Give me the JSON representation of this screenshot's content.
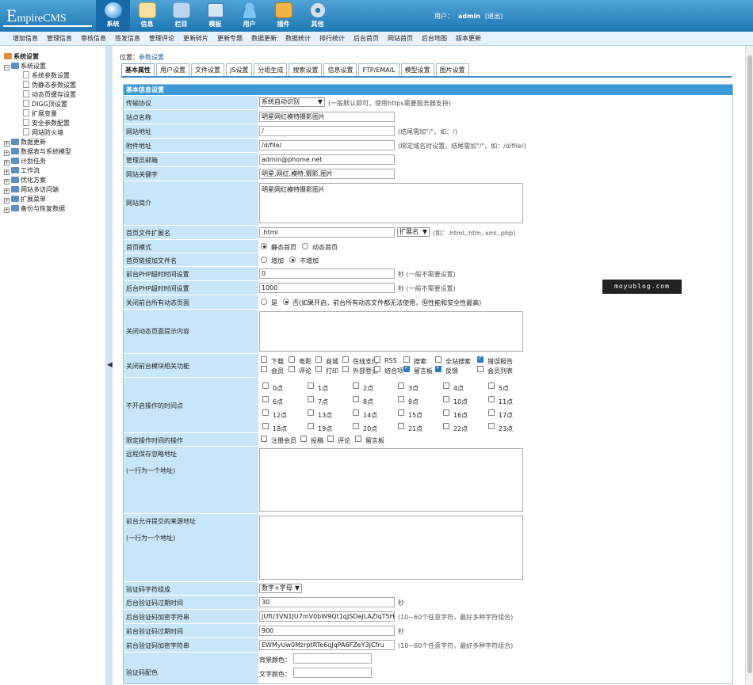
{
  "brand": {
    "logo_text": "EmpireCMS"
  },
  "nav": [
    {
      "label": "系统",
      "icon": "globe-icon",
      "active": true
    },
    {
      "label": "信息",
      "icon": "pencil-icon"
    },
    {
      "label": "栏目",
      "icon": "folder-icon"
    },
    {
      "label": "模板",
      "icon": "window-icon"
    },
    {
      "label": "用户",
      "icon": "user-icon"
    },
    {
      "label": "插件",
      "icon": "puzzle-icon"
    },
    {
      "label": "其他",
      "icon": "gear-icon"
    }
  ],
  "user": {
    "prefix": "用户：",
    "name": "admin",
    "logout": "[退出]"
  },
  "menu": [
    "增加信息",
    "管理信息",
    "审核信息",
    "签发信息",
    "管理评论",
    "更新碎片",
    "更新专题",
    "数据更新",
    "数据统计",
    "排行统计",
    "后台首页",
    "网站首页",
    "后台地图",
    "版本更新"
  ],
  "tree": {
    "root": "系统设置",
    "group": "系统设置",
    "pages": [
      "系统参数设置",
      "伪静态参数设置",
      "动态页缓存设置",
      "DIGG顶设置",
      "扩展变量",
      "安全参数配置",
      "网站防火墙"
    ],
    "others": [
      "数据更新",
      "数据表与系统模型",
      "计划任务",
      "工作流",
      "优化方案",
      "网站多访问端",
      "扩展菜单",
      "备份与恢复数据"
    ]
  },
  "splitter_arrow": "◀",
  "breadcrumb": {
    "label": "位置：",
    "link": "参数设置"
  },
  "tabs": [
    "基本属性",
    "用户设置",
    "文件设置",
    "JS设置",
    "分组生成",
    "搜索设置",
    "信息设置",
    "FTP/EMAIL",
    "模型设置",
    "图片设置"
  ],
  "form": {
    "header": "基本信息设置",
    "transfer": {
      "label": "传输协议",
      "value": "系统自动识别",
      "note": "(一般默认即可，使用https需要服务器支持)"
    },
    "site_name": {
      "label": "站点名称",
      "value": "明星网红模特摄影图片"
    },
    "site_url": {
      "label": "网站地址",
      "value": "/",
      "note": "(结尾需加\"/\"，如：/)"
    },
    "file_url": {
      "label": "附件地址",
      "value": "/d/file/",
      "note": "(绑定域名时设置，结尾需加\"/\"，如：/d/file/)"
    },
    "admin_email": {
      "label": "管理员邮箱",
      "value": "admin@phome.net"
    },
    "keywords": {
      "label": "网站关键字",
      "value": "明星,网红,模特,摄影,图片"
    },
    "intro": {
      "label": "网站简介",
      "value": "明星网红模特摄影图片"
    },
    "index_ext": {
      "label": "首页文件扩展名",
      "value": ".html",
      "select": "扩展名",
      "note": "(如：.html,.htm,.xml,.php)"
    },
    "index_mode": {
      "label": "首页模式",
      "opt1": "静态首页",
      "opt2": "动态首页"
    },
    "index_link": {
      "label": "首页链接加文件名",
      "opt1": "增加",
      "opt2": "不增加"
    },
    "front_timeout": {
      "label": "前台PHP超时时间设置",
      "value": "0",
      "note": "秒 (一般不需要设置)"
    },
    "back_timeout": {
      "label": "后台PHP超时时间设置",
      "value": "1000",
      "note": "秒 (一般不需要设置)"
    },
    "close_dynamic": {
      "label": "关闭前台所有动态页面",
      "opt1": "是",
      "opt2": "否(如果开启，前台所有动态文件都无法使用，但性能和安全性最高)"
    },
    "close_tip": {
      "label": "关闭动态页面提示内容"
    },
    "close_modules": {
      "label": "关闭前台模块相关功能",
      "items": [
        {
          "t": "下载",
          "c": false
        },
        {
          "t": "电影",
          "c": false
        },
        {
          "t": "商城",
          "c": false
        },
        {
          "t": "在线支付",
          "c": false
        },
        {
          "t": "RSS",
          "c": false
        },
        {
          "t": "搜索",
          "c": false
        },
        {
          "t": "全站搜索",
          "c": false
        },
        {
          "t": "错误报告",
          "c": true
        },
        {
          "t": "会员",
          "c": false
        },
        {
          "t": "评论",
          "c": false
        },
        {
          "t": "打印",
          "c": false
        },
        {
          "t": "外部登录",
          "c": false
        },
        {
          "t": "结合项",
          "c": false
        },
        {
          "t": "留言板",
          "c": true
        },
        {
          "t": "反馈",
          "c": true
        },
        {
          "t": "会员列表",
          "c": false
        }
      ]
    },
    "closed_hours": {
      "label": "不开启操作的时间点",
      "hours": [
        "0点",
        "1点",
        "2点",
        "3点",
        "4点",
        "5点",
        "6点",
        "7点",
        "8点",
        "9点",
        "10点",
        "11点",
        "12点",
        "13点",
        "14点",
        "15点",
        "16点",
        "17点",
        "18点",
        "19点",
        "20点",
        "21点",
        "22点",
        "23点"
      ]
    },
    "limit_ops": {
      "label": "限定操作时间的操作",
      "items": [
        "注册会员",
        "投稿",
        "评论",
        "留言板"
      ]
    },
    "remote_ignore": {
      "label": "远程保存忽略地址",
      "hint": "(一行为一个地址)"
    },
    "allow_source": {
      "label": "前台允许提交的来源地址",
      "hint": "(一行为一个地址)"
    },
    "code_chars": {
      "label": "验证码字符组成",
      "value": "数字+字母"
    },
    "back_code_expire": {
      "label": "后台验证码过期时间",
      "value": "30",
      "note": "秒"
    },
    "back_code_key": {
      "label": "后台验证码加密字符串",
      "value": "JUfU3VN1JU7mV0bW9Qt1qJSDeJLAZlqT5HzW",
      "note": "(10~60个任意字符，最好多种字符组合)"
    },
    "front_code_expire": {
      "label": "前台验证码过期时间",
      "value": "900",
      "note": "秒"
    },
    "front_code_key": {
      "label": "前台验证码加密字符串",
      "value": "EWMyUw0MzrptRTe6qJqPA6FZeY3JCfru",
      "note": "(10~60个任意字符，最好多种字符组合)"
    },
    "code_color": {
      "label": "验证码配色",
      "bg": "背景颜色：",
      "fg": "文字颜色："
    }
  },
  "watermark": "moyublog.com",
  "colors": {
    "header": "#3d9ad8",
    "label_bg": "#c7e7f9",
    "topbar": "#1f78b4"
  }
}
